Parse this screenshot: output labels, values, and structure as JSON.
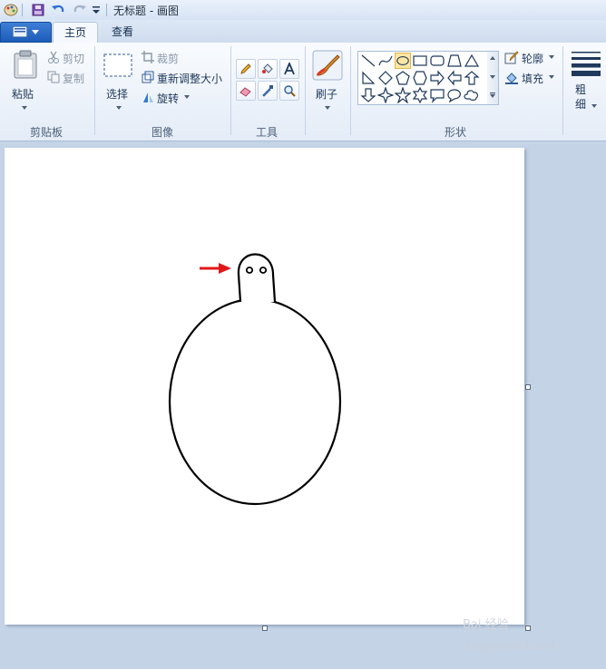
{
  "window": {
    "title": "无标题 - 画图"
  },
  "tabs": [
    {
      "label": "主页",
      "active": true
    },
    {
      "label": "查看",
      "active": false
    }
  ],
  "clipboard": {
    "paste_label": "粘贴",
    "cut_label": "剪切",
    "copy_label": "复制",
    "group_label": "剪贴板"
  },
  "image": {
    "select_label": "选择",
    "crop_label": "裁剪",
    "resize_label": "重新调整大小",
    "rotate_label": "旋转",
    "group_label": "图像"
  },
  "tools": {
    "group_label": "工具"
  },
  "brushes": {
    "label": "刷子"
  },
  "shapes": {
    "outline_label": "轮廓",
    "fill_label": "填充",
    "group_label": "形状"
  },
  "size": {
    "label": "粗细"
  },
  "watermark": {
    "text": "Bai 经验",
    "url": "jingyan.baidu.com"
  },
  "colors": {
    "accent": "#1d5bb8",
    "arrow": "#e01818",
    "selected_shape": "#fde7a4"
  }
}
